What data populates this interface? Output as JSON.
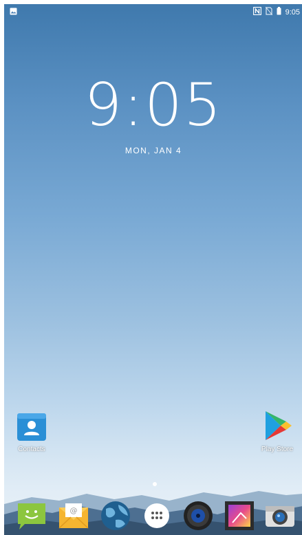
{
  "status_bar": {
    "time": "9:05",
    "icons": [
      "gallery-notification-icon",
      "nfc-icon",
      "no-sim-icon",
      "battery-icon"
    ]
  },
  "lockscreen": {
    "clock": "9:05",
    "date": "MON, JAN 4"
  },
  "home_apps": [
    {
      "label": "Contacts",
      "icon": "contacts-icon"
    },
    {
      "label": "Play Store",
      "icon": "play-store-icon"
    }
  ],
  "dock": {
    "apps": [
      "messaging-icon",
      "email-icon",
      "browser-icon",
      "app-drawer-icon",
      "music-icon",
      "gallery-icon",
      "camera-icon"
    ]
  },
  "colors": {
    "sky_top": "#3f79ad",
    "sky_bottom": "#e8f0f7",
    "contacts_blue": "#2a8fd6",
    "messaging_green": "#8cc63f"
  }
}
